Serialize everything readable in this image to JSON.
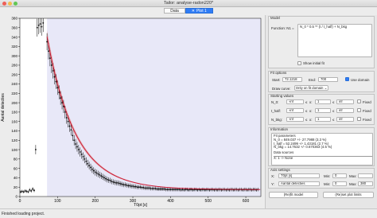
{
  "window": {
    "title": "Tailor: analyse-radon220*"
  },
  "tabs": [
    {
      "label": "Data"
    },
    {
      "label": "Plot 1"
    }
  ],
  "plot": {
    "xlabel": "T0pt [s]",
    "ylabel": "Aantal detecties",
    "xticks": [
      "0",
      "100",
      "200",
      "300",
      "400",
      "500",
      "600"
    ],
    "yticks": [
      "0",
      "20",
      "40",
      "60",
      "80",
      "100",
      "120",
      "140",
      "160",
      "180",
      "200",
      "220",
      "240",
      "260",
      "280",
      "300",
      "320",
      "340",
      "360",
      "380"
    ],
    "colors": {
      "data": "#000000",
      "fit": "#c8102e",
      "fit_domain_shade": "#e8e8f8",
      "error_band": "#e6a0a0"
    }
  },
  "chart_data": {
    "type": "scatter",
    "xlabel": "T0pt [s]",
    "ylabel": "Aantal detecties",
    "xlim": [
      0,
      640
    ],
    "ylim": [
      0,
      380
    ],
    "fit_domain": [
      72.1218,
      700
    ],
    "fit_function": "N_0 * 0.5 ** (t / t_half) + N_bkg",
    "fit_parameters": {
      "N_0": 849.037,
      "t_half": 52.2499,
      "N_bkg": 14.7632
    },
    "points": [
      [
        2,
        10
      ],
      [
        6,
        11
      ],
      [
        10,
        10
      ],
      [
        14,
        12
      ],
      [
        18,
        11
      ],
      [
        22,
        10
      ],
      [
        26,
        14
      ],
      [
        30,
        12
      ],
      [
        34,
        16
      ],
      [
        38,
        13
      ],
      [
        42,
        100
      ],
      [
        46,
        360
      ],
      [
        50,
        365
      ],
      [
        54,
        368
      ],
      [
        58,
        362
      ],
      [
        62,
        370
      ],
      [
        72,
        330
      ],
      [
        76,
        310
      ],
      [
        80,
        295
      ],
      [
        84,
        280
      ],
      [
        88,
        268
      ],
      [
        92,
        255
      ],
      [
        96,
        245
      ],
      [
        100,
        232
      ],
      [
        104,
        222
      ],
      [
        108,
        210
      ],
      [
        112,
        200
      ],
      [
        116,
        192
      ],
      [
        120,
        180
      ],
      [
        124,
        168
      ],
      [
        128,
        160
      ],
      [
        132,
        150
      ],
      [
        136,
        142
      ],
      [
        140,
        130
      ],
      [
        144,
        120
      ],
      [
        148,
        112
      ],
      [
        152,
        106
      ],
      [
        156,
        100
      ],
      [
        160,
        95
      ],
      [
        164,
        90
      ],
      [
        168,
        85
      ],
      [
        172,
        80
      ],
      [
        176,
        75
      ],
      [
        180,
        70
      ],
      [
        184,
        66
      ],
      [
        188,
        62
      ],
      [
        192,
        58
      ],
      [
        196,
        55
      ],
      [
        200,
        52
      ],
      [
        204,
        50
      ],
      [
        208,
        48
      ],
      [
        212,
        46
      ],
      [
        216,
        44
      ],
      [
        220,
        42
      ],
      [
        224,
        40
      ],
      [
        228,
        38
      ],
      [
        232,
        36
      ],
      [
        236,
        35
      ],
      [
        240,
        34
      ],
      [
        244,
        32
      ],
      [
        248,
        31
      ],
      [
        252,
        30
      ],
      [
        256,
        29
      ],
      [
        260,
        29
      ],
      [
        264,
        28
      ],
      [
        268,
        27
      ],
      [
        272,
        26
      ],
      [
        276,
        25
      ],
      [
        280,
        25
      ],
      [
        284,
        24
      ],
      [
        288,
        23
      ],
      [
        292,
        23
      ],
      [
        296,
        22
      ],
      [
        300,
        22
      ],
      [
        304,
        21
      ],
      [
        308,
        21
      ],
      [
        312,
        20
      ],
      [
        316,
        20
      ],
      [
        320,
        20
      ],
      [
        324,
        19
      ],
      [
        328,
        19
      ],
      [
        332,
        18
      ],
      [
        336,
        18
      ],
      [
        340,
        18
      ],
      [
        344,
        18
      ],
      [
        348,
        17
      ],
      [
        352,
        17
      ],
      [
        356,
        17
      ],
      [
        360,
        17
      ],
      [
        364,
        16
      ],
      [
        368,
        16
      ],
      [
        372,
        16
      ],
      [
        376,
        16
      ],
      [
        380,
        16
      ],
      [
        384,
        16
      ],
      [
        388,
        15
      ],
      [
        392,
        15
      ],
      [
        396,
        15
      ],
      [
        400,
        15
      ],
      [
        404,
        15
      ],
      [
        408,
        15
      ],
      [
        412,
        15
      ],
      [
        416,
        15
      ],
      [
        420,
        15
      ],
      [
        424,
        15
      ],
      [
        428,
        14
      ],
      [
        432,
        15
      ],
      [
        436,
        14
      ],
      [
        440,
        15
      ],
      [
        444,
        15
      ],
      [
        448,
        14
      ],
      [
        452,
        15
      ],
      [
        456,
        15
      ],
      [
        460,
        14
      ],
      [
        464,
        15
      ],
      [
        468,
        15
      ],
      [
        472,
        14
      ],
      [
        476,
        15
      ],
      [
        480,
        14
      ],
      [
        484,
        15
      ],
      [
        488,
        15
      ],
      [
        492,
        14
      ],
      [
        496,
        15
      ],
      [
        500,
        15
      ],
      [
        504,
        14
      ],
      [
        508,
        15
      ],
      [
        512,
        15
      ],
      [
        516,
        14
      ],
      [
        520,
        15
      ],
      [
        524,
        14
      ],
      [
        528,
        15
      ],
      [
        532,
        15
      ],
      [
        536,
        14
      ],
      [
        540,
        15
      ],
      [
        544,
        15
      ],
      [
        548,
        14
      ],
      [
        552,
        15
      ],
      [
        556,
        14
      ],
      [
        560,
        15
      ],
      [
        564,
        15
      ],
      [
        568,
        14
      ],
      [
        572,
        15
      ],
      [
        576,
        15
      ],
      [
        580,
        14
      ],
      [
        584,
        15
      ],
      [
        588,
        15
      ],
      [
        592,
        14
      ],
      [
        596,
        15
      ],
      [
        600,
        15
      ],
      [
        604,
        14
      ],
      [
        608,
        15
      ],
      [
        612,
        15
      ],
      [
        616,
        14
      ],
      [
        620,
        15
      ],
      [
        624,
        15
      ],
      [
        628,
        14
      ],
      [
        632,
        15
      ]
    ],
    "error": "sqrt"
  },
  "model": {
    "header": "Model",
    "function_label": "Function:  N1 =",
    "function_value": "N_0 * 0.5 ** (t / t_half) + N_bkg",
    "show_initial_fit_label": "Show initial fit",
    "show_initial_fit": false
  },
  "fit_options": {
    "header": "Fit options",
    "start_label": "Start:",
    "start_value": "72.1218",
    "end_label": "End:",
    "end_value": "700",
    "use_domain_label": "Use domain",
    "use_domain": true,
    "draw_curve_label": "Draw curve:",
    "draw_curve_value": "Only on fit domain"
  },
  "starting_values": {
    "header": "Starting values",
    "params": [
      {
        "name": "N_0:",
        "value": "1",
        "lower_bound": "-inf",
        "upper_bound": "inf",
        "fixed_label": "Fixed"
      },
      {
        "name": "t_half:",
        "value": "1",
        "lower_bound": "-inf",
        "upper_bound": "inf",
        "fixed_label": "Fixed"
      },
      {
        "name": "N_bkg:",
        "value": "1",
        "lower_bound": "-inf",
        "upper_bound": "inf",
        "fixed_label": "Fixed"
      }
    ],
    "lt_symbol": "≤",
    "x_symbol": "x:"
  },
  "information": {
    "header": "Information",
    "lines": [
      "Fit parameters",
      "N_0 = 849.037  +/- 27.7988  (3.3 %)",
      "t_half = 52.2499  +/- 1.43181  (2.7 %)",
      "N_bkg = 14.7632  +/- 0.670363  (4.5 %)"
    ],
    "data_sources": "Data sources",
    "data_sources_line": "X: 1 -> None"
  },
  "axis_settings": {
    "header": "Axis settings",
    "x_label": "X:",
    "x_value": "T0pt [s]",
    "x_min_label": "Min:",
    "x_min": "0",
    "x_max_label": "Max:",
    "x_max": "",
    "y_label": "Y:",
    "y_value": "Aantal detecties",
    "y_min_label": "Min:",
    "y_min": "0",
    "y_max_label": "Max:",
    "y_max": "380"
  },
  "buttons": {
    "refit": "(Re)fit model",
    "replot": "(Re)set plot limits"
  },
  "status": {
    "text": "Finished loading project."
  }
}
